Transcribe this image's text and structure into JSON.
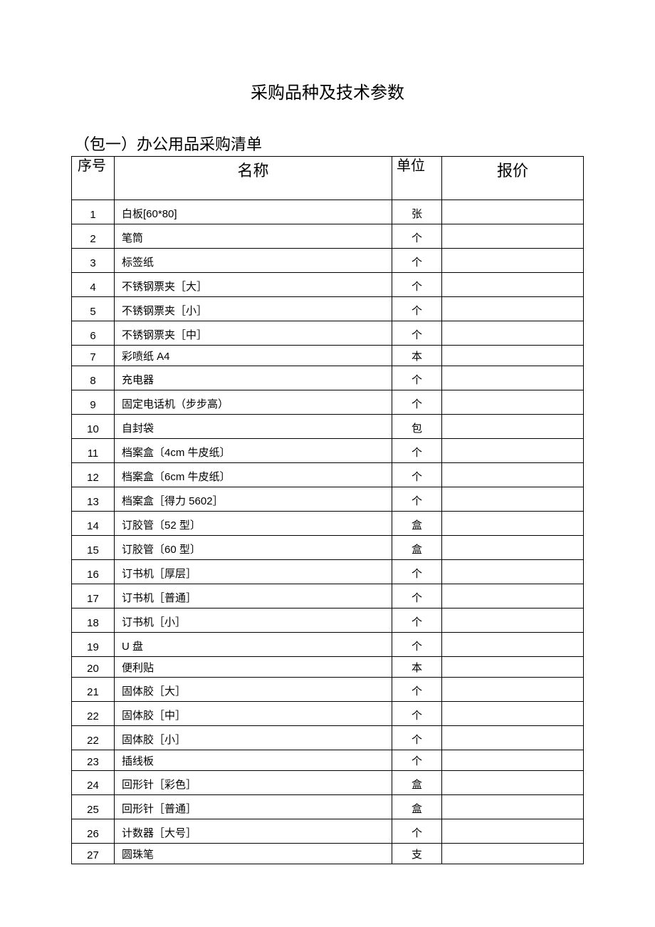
{
  "title": "采购品种及技术参数",
  "subtitle": "（包一）办公用品采购清单",
  "headers": {
    "seq": "序号",
    "name": "名称",
    "unit": "单位",
    "price": "报价"
  },
  "rows": [
    {
      "seq": "1",
      "name": "白板[60*80]",
      "unit": "张",
      "price": "",
      "short": false
    },
    {
      "seq": "2",
      "name": "笔筒",
      "unit": "个",
      "price": "",
      "short": false
    },
    {
      "seq": "3",
      "name": "标签纸",
      "unit": "个",
      "price": "",
      "short": false
    },
    {
      "seq": "4",
      "name": "不锈钢票夹［大］",
      "unit": "个",
      "price": "",
      "short": false
    },
    {
      "seq": "5",
      "name": "不锈钢票夹［小］",
      "unit": "个",
      "price": "",
      "short": false
    },
    {
      "seq": "6",
      "name": "不锈钢票夹［中］",
      "unit": "个",
      "price": "",
      "short": false
    },
    {
      "seq": "7",
      "name": "彩喷纸 A4",
      "unit": "本",
      "price": "",
      "short": true
    },
    {
      "seq": "8",
      "name": "充电器",
      "unit": "个",
      "price": "",
      "short": false
    },
    {
      "seq": "9",
      "name": "固定电话机（步步高）",
      "unit": "个",
      "price": "",
      "short": false
    },
    {
      "seq": "10",
      "name": "自封袋",
      "unit": "包",
      "price": "",
      "short": false
    },
    {
      "seq": "11",
      "name": "档案盒〔4cm 牛皮纸〕",
      "unit": "个",
      "price": "",
      "short": false
    },
    {
      "seq": "12",
      "name": "档案盒〔6cm 牛皮纸〕",
      "unit": "个",
      "price": "",
      "short": false
    },
    {
      "seq": "13",
      "name": "档案盒［得力 5602］",
      "unit": "个",
      "price": "",
      "short": false
    },
    {
      "seq": "14",
      "name": "订胶管〔52 型〕",
      "unit": "盒",
      "price": "",
      "short": false
    },
    {
      "seq": "15",
      "name": "订胶管〔60 型〕",
      "unit": "盒",
      "price": "",
      "short": false
    },
    {
      "seq": "16",
      "name": "订书机［厚层］",
      "unit": "个",
      "price": "",
      "short": false
    },
    {
      "seq": "17",
      "name": "订书机［普通］",
      "unit": "个",
      "price": "",
      "short": false
    },
    {
      "seq": "18",
      "name": "订书机［小］",
      "unit": "个",
      "price": "",
      "short": false
    },
    {
      "seq": "19",
      "name": "U 盘",
      "unit": "个",
      "price": "",
      "short": false
    },
    {
      "seq": "20",
      "name": "便利贴",
      "unit": "本",
      "price": "",
      "short": true
    },
    {
      "seq": "21",
      "name": "固体胶［大］",
      "unit": "个",
      "price": "",
      "short": false
    },
    {
      "seq": "22",
      "name": "固体胶［中］",
      "unit": "个",
      "price": "",
      "short": false
    },
    {
      "seq": "22",
      "name": "固体胶［小］",
      "unit": "个",
      "price": "",
      "short": false
    },
    {
      "seq": "23",
      "name": "插线板",
      "unit": "个",
      "price": "",
      "short": true
    },
    {
      "seq": "24",
      "name": "回形针［彩色］",
      "unit": "盒",
      "price": "",
      "short": false
    },
    {
      "seq": "25",
      "name": "回形针［普通］",
      "unit": "盒",
      "price": "",
      "short": false
    },
    {
      "seq": "26",
      "name": "计数器［大号］",
      "unit": "个",
      "price": "",
      "short": false
    },
    {
      "seq": "27",
      "name": "圆珠笔",
      "unit": "支",
      "price": "",
      "short": true
    }
  ]
}
